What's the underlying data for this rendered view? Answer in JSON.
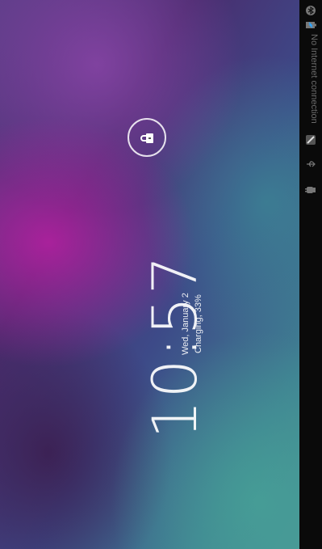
{
  "lockscreen": {
    "time": "10:57",
    "date": "Wed, January 2",
    "charging": "Charging, 33%"
  },
  "status_bar": {
    "network_text": "No Internet connection",
    "icons": [
      "bluetooth-icon",
      "battery-icon",
      "pen-icon",
      "usb-icon",
      "android-debug-icon"
    ]
  },
  "colors": {
    "accent_white": "#ffffff",
    "status_bar_bg": "#0a0a0a"
  }
}
